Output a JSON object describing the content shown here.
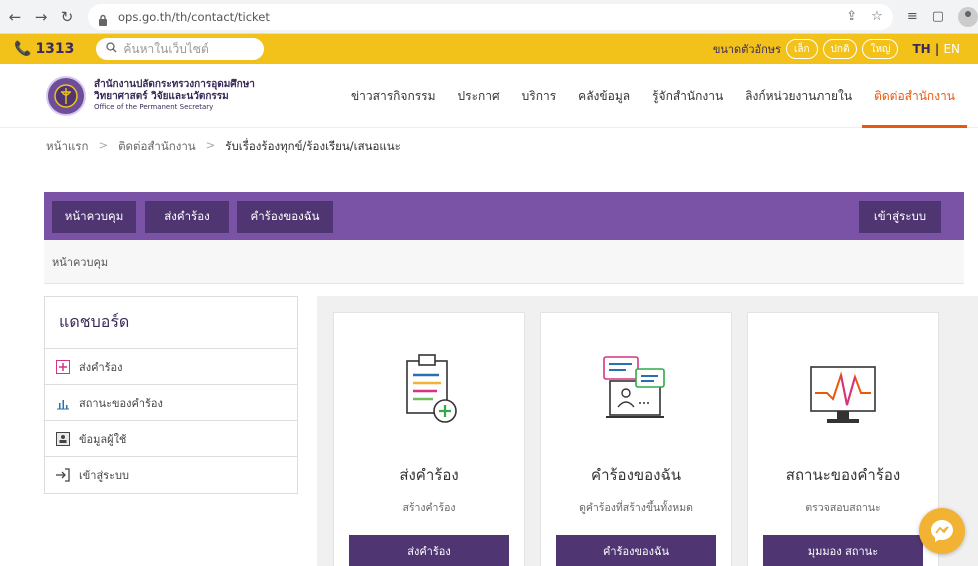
{
  "browser": {
    "url": "ops.go.th/th/contact/ticket"
  },
  "topbar": {
    "hotline": "1313",
    "search_placeholder": "ค้นหาในเว็บไซต์",
    "font_size_label": "ขนาดตัวอักษร",
    "font_sizes": [
      "เล็ก",
      "ปกติ",
      "ใหญ่"
    ],
    "lang_th": "TH",
    "lang_sep": " | ",
    "lang_en": "EN"
  },
  "header": {
    "org_line1": "สำนักงานปลัดกระทรวงการอุดมศึกษา",
    "org_line2": "วิทยาศาสตร์ วิจัยและนวัตกรรม",
    "org_line3": "Office of the Permanent Secretary",
    "nav": [
      "ข่าวสารกิจกรรม",
      "ประกาศ",
      "บริการ",
      "คลังข้อมูล",
      "รู้จักสำนักงาน",
      "ลิงก์หน่วยงานภายใน",
      "ติดต่อสำนักงาน"
    ]
  },
  "breadcrumb": {
    "home": "หน้าแรก",
    "contact": "ติดต่อสำนักงาน",
    "current": "รับเรื่องร้องทุกข์/ร้องเรียน/เสนอแนะ",
    "sep": ">"
  },
  "toolbar": {
    "dashboard": "หน้าควบคุม",
    "send": "ส่งคำร้อง",
    "mine": "คำร้องของฉัน",
    "login": "เข้าสู่ระบบ",
    "subbar": "หน้าควบคุม"
  },
  "sidebar": {
    "title": "แดชบอร์ด",
    "items": [
      "ส่งคำร้อง",
      "สถานะของคำร้อง",
      "ข้อมูลผู้ใช้",
      "เข้าสู่ระบบ"
    ]
  },
  "cards": [
    {
      "title": "ส่งคำร้อง",
      "subtitle": "สร้างคำร้อง",
      "button": "ส่งคำร้อง"
    },
    {
      "title": "คำร้องของฉัน",
      "subtitle": "ดูคำร้องที่สร้างขึ้นทั้งหมด",
      "button": "คำร้องของฉัน"
    },
    {
      "title": "สถานะของคำร้อง",
      "subtitle": "ตรวจสอบสถานะ",
      "button": "มุมมอง สถานะ"
    }
  ],
  "colors": {
    "accent_yellow": "#f2c21a",
    "brand_purple": "#7b53a6",
    "dark_purple": "#4f3672",
    "active_orange": "#e8590c"
  }
}
